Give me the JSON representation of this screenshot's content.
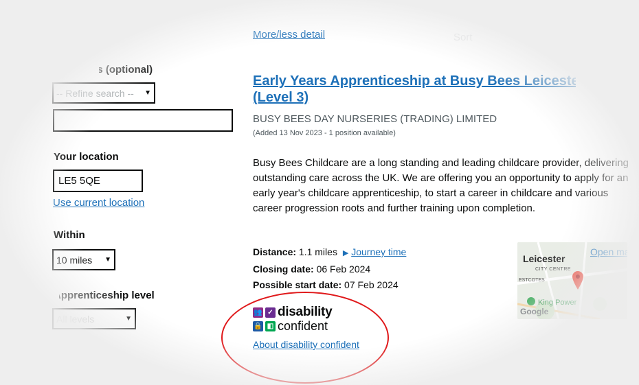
{
  "sidebar": {
    "keyword_label": "Keywords (optional)",
    "refine_select_value": "-- Refine search --",
    "keyword_value": "",
    "location_label": "Your location",
    "location_value": "LE5 5QE",
    "use_current_location": "Use current location",
    "within_label": "Within",
    "within_value": "10 miles",
    "level_label": "Apprenticeship level",
    "level_value": "All levels"
  },
  "top": {
    "more_less_detail": "More/less detail",
    "sort_faded": "Sort"
  },
  "listing": {
    "title_line1": "Early Years Apprenticeship at Busy Bees Leicester",
    "title_line2": "(Level 3)",
    "employer": "BUSY BEES DAY NURSERIES (TRADING) LIMITED",
    "added": "(Added 13 Nov 2023 - 1 position available)",
    "description": "Busy Bees Childcare are a long standing and leading childcare provider, delivering outstanding care across the UK. We are offering you an opportunity to apply for an early year's childcare apprenticeship, to start a career in childcare and various career progression roots and further training upon completion.",
    "distance_label": "Distance:",
    "distance_value": "1.1 miles",
    "journey_time": "Journey time",
    "closing_label": "Closing date:",
    "closing_value": "06 Feb 2024",
    "start_label": "Possible start date:",
    "start_value": "07 Feb 2024",
    "disability_word1": "disability",
    "disability_word2": "confident",
    "about_disability": "About disability confident"
  },
  "map": {
    "open_map": "Open map",
    "city": "Leicester",
    "city_centre": "CITY CENTRE",
    "estcotes": "ESTCOTES",
    "king_power": "King Power",
    "google": "Google"
  },
  "colors": {
    "link": "#1d70b8",
    "text": "#0b0c0c",
    "secondary": "#505a5f",
    "annotation_circle": "#e0191b",
    "dc_purple": "#912b88",
    "dc_blue": "#1d5aa6",
    "dc_green": "#00a651"
  }
}
